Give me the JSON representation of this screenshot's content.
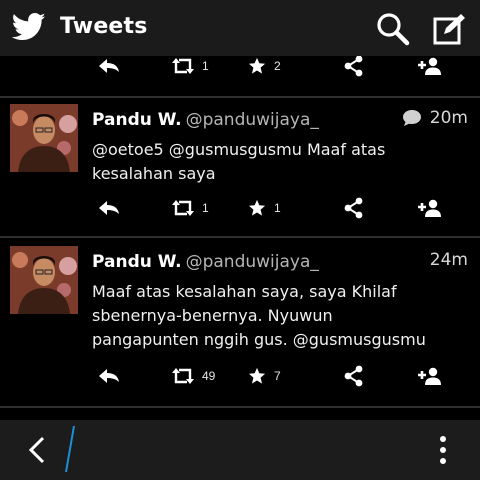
{
  "header": {
    "title": "Tweets",
    "bird_icon": "twitter-bird-icon",
    "search_icon": "search-icon",
    "compose_icon": "compose-icon"
  },
  "top_actions": {
    "retweets": "1",
    "favorites": "2"
  },
  "tweets": [
    {
      "name": "Pandu W.",
      "handle": "@panduwijaya_",
      "time": "20m",
      "has_reply_bubble": true,
      "lines": [
        "@oetoe5 @gusmusgusmu Maaf atas",
        "kesalahan saya"
      ],
      "retweets": "1",
      "favorites": "1"
    },
    {
      "name": "Pandu W.",
      "handle": "@panduwijaya_",
      "time": "24m",
      "has_reply_bubble": false,
      "lines": [
        "Maaf atas kesalahan saya, saya Khilaf",
        "sbenernya-benernya. Nyuwun",
        "pangapunten nggih gus. @gusmusgusmu"
      ],
      "retweets": "49",
      "favorites": "7"
    }
  ],
  "colors": {
    "header_bg": "#1b1b1b",
    "feed_bg": "#000000",
    "bottombar_bg": "#1c1c1c",
    "cursor": "#1e8fd6"
  },
  "bottombar": {
    "back_icon": "chevron-left-icon",
    "more_icon": "overflow-menu-icon"
  }
}
